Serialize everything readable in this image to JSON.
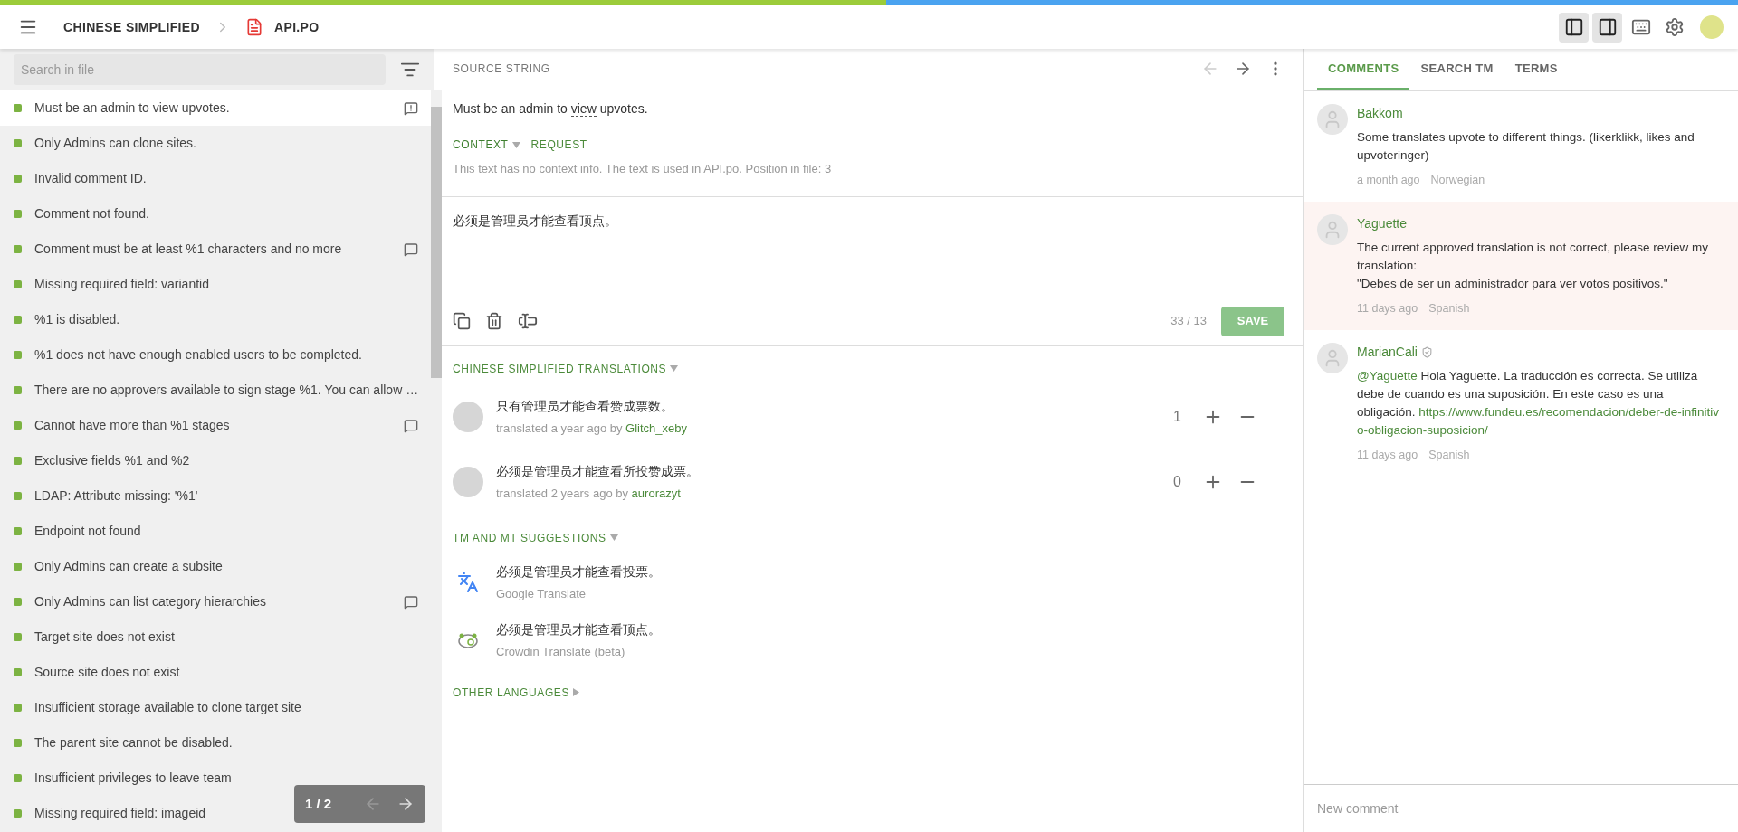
{
  "progress": {
    "level": 0.51
  },
  "header": {
    "language": "CHINESE SIMPLIFIED",
    "file": "API.PO",
    "toolbar": [
      {
        "kind": "left-panel",
        "on": true
      },
      {
        "kind": "right-panel",
        "on": true
      },
      {
        "kind": "keyboard",
        "on": false
      },
      {
        "kind": "settings",
        "on": false
      }
    ]
  },
  "sidebar": {
    "search": {
      "placeholder": "Search in file"
    },
    "strings": [
      {
        "text": "Must be an admin to view upvotes.",
        "color": "#7cb342",
        "kind": "issue",
        "selected": true
      },
      {
        "text": "Only Admins can clone sites.",
        "color": "#7cb342",
        "kind": "plain",
        "selected": false
      },
      {
        "text": "Invalid comment ID.",
        "color": "#7cb342",
        "kind": "plain",
        "selected": false
      },
      {
        "text": "Comment not found.",
        "color": "#7cb342",
        "kind": "plain",
        "selected": false
      },
      {
        "text": "Comment must be at least %1 characters and no more",
        "color": "#7cb342",
        "kind": "comment",
        "selected": false
      },
      {
        "text": "Missing required field: variantid",
        "color": "#7cb342",
        "kind": "plain",
        "selected": false
      },
      {
        "text": "%1 is disabled.",
        "color": "#7cb342",
        "kind": "plain",
        "selected": false
      },
      {
        "text": "%1 does not have enough enabled users to be completed.",
        "color": "#7cb342",
        "kind": "plain",
        "selected": false
      },
      {
        "text": "There are no approvers available to sign stage %1. You can allow …",
        "color": "#7cb342",
        "kind": "plain",
        "selected": false
      },
      {
        "text": "Cannot have more than %1 stages",
        "color": "#7cb342",
        "kind": "comment",
        "selected": false
      },
      {
        "text": "Exclusive fields %1 and %2",
        "color": "#7cb342",
        "kind": "plain",
        "selected": false
      },
      {
        "text": "LDAP: Attribute missing: '%1'",
        "color": "#7cb342",
        "kind": "plain",
        "selected": false
      },
      {
        "text": "Endpoint not found",
        "color": "#7cb342",
        "kind": "plain",
        "selected": false
      },
      {
        "text": "Only Admins can create a subsite",
        "color": "#7cb342",
        "kind": "plain",
        "selected": false
      },
      {
        "text": "Only Admins can list category hierarchies",
        "color": "#7cb342",
        "kind": "comment",
        "selected": false
      },
      {
        "text": "Target site does not exist",
        "color": "#7cb342",
        "kind": "plain",
        "selected": false
      },
      {
        "text": "Source site does not exist",
        "color": "#7cb342",
        "kind": "plain",
        "selected": false
      },
      {
        "text": "Insufficient storage available to clone target site",
        "color": "#7cb342",
        "kind": "plain",
        "selected": false
      },
      {
        "text": "The parent site cannot be disabled.",
        "color": "#7cb342",
        "kind": "plain",
        "selected": false
      },
      {
        "text": "Insufficient privileges to leave team",
        "color": "#7cb342",
        "kind": "plain",
        "selected": false
      },
      {
        "text": "Missing required field: imageid",
        "color": "#7cb342",
        "kind": "plain",
        "selected": false
      }
    ],
    "pager": {
      "page": "1 / 2",
      "prev_disabled": true
    }
  },
  "source": {
    "label": "SOURCE STRING",
    "prev_disabled": true,
    "segments": [
      {
        "text": "Must be an admin to ",
        "kind": "text"
      },
      {
        "text": "view",
        "kind": "term"
      },
      {
        "text": " upvotes.",
        "kind": "text"
      }
    ],
    "tabs": [
      {
        "label": "CONTEXT",
        "selected": true
      },
      {
        "label": "REQUEST",
        "selected": false
      }
    ],
    "context": "This text has no context info. The text is used in API.po. Position in file: 3"
  },
  "editor": {
    "value": "必须是管理员才能查看顶点。",
    "counter": "33 / 13",
    "save": "SAVE"
  },
  "translations": {
    "title": "CHINESE SIMPLIFIED TRANSLATIONS",
    "items": [
      {
        "text": "只有管理员才能查看赞成票数。",
        "meta": "translated a year ago by",
        "author": "Glitch_xeby",
        "votes": "1"
      },
      {
        "text": "必须是管理员才能查看所投赞成票。",
        "meta": "translated 2 years ago by",
        "author": "aurorazyt",
        "votes": "0"
      }
    ]
  },
  "suggestions": {
    "title": "TM AND MT SUGGESTIONS",
    "items": [
      {
        "text": "必须是管理员才能查看投票。",
        "source": "Google Translate",
        "kind": "google"
      },
      {
        "text": "必须是管理员才能查看顶点。",
        "source": "Crowdin Translate (beta)",
        "kind": "crowdin"
      }
    ]
  },
  "other_languages": {
    "title": "OTHER LANGUAGES"
  },
  "right": {
    "tabs": [
      {
        "label": "COMMENTS",
        "selected": true
      },
      {
        "label": "SEARCH TM",
        "selected": false
      },
      {
        "label": "TERMS",
        "selected": false
      }
    ],
    "comments": [
      {
        "author": "Bakkom",
        "verified": false,
        "highlighted": false,
        "body": [
          {
            "text": "Some translates upvote to different things. (likerklikk, likes and upvoteringer)",
            "kind": "text"
          }
        ],
        "time": "a month ago",
        "language": "Norwegian"
      },
      {
        "author": "Yaguette",
        "verified": false,
        "highlighted": true,
        "body": [
          {
            "text": "The current approved translation is not correct, please review my translation:\n\"Debes de ser un administrador para ver votos positivos.\"",
            "kind": "text"
          }
        ],
        "time": "11 days ago",
        "language": "Spanish"
      },
      {
        "author": "MarianCali",
        "verified": true,
        "highlighted": false,
        "body": [
          {
            "text": "@Yaguette",
            "kind": "mention"
          },
          {
            "text": " Hola Yaguette. La traducción es correcta. Se utiliza debe de cuando es una suposición. En este caso es una obligación. ",
            "kind": "text"
          },
          {
            "text": "https://www.fundeu.es/recomendacion/deber-de-infinitivo-obligacion-suposicion/",
            "kind": "link"
          }
        ],
        "time": "11 days ago",
        "language": "Spanish"
      }
    ],
    "new_comment": {
      "placeholder": "New comment"
    }
  }
}
